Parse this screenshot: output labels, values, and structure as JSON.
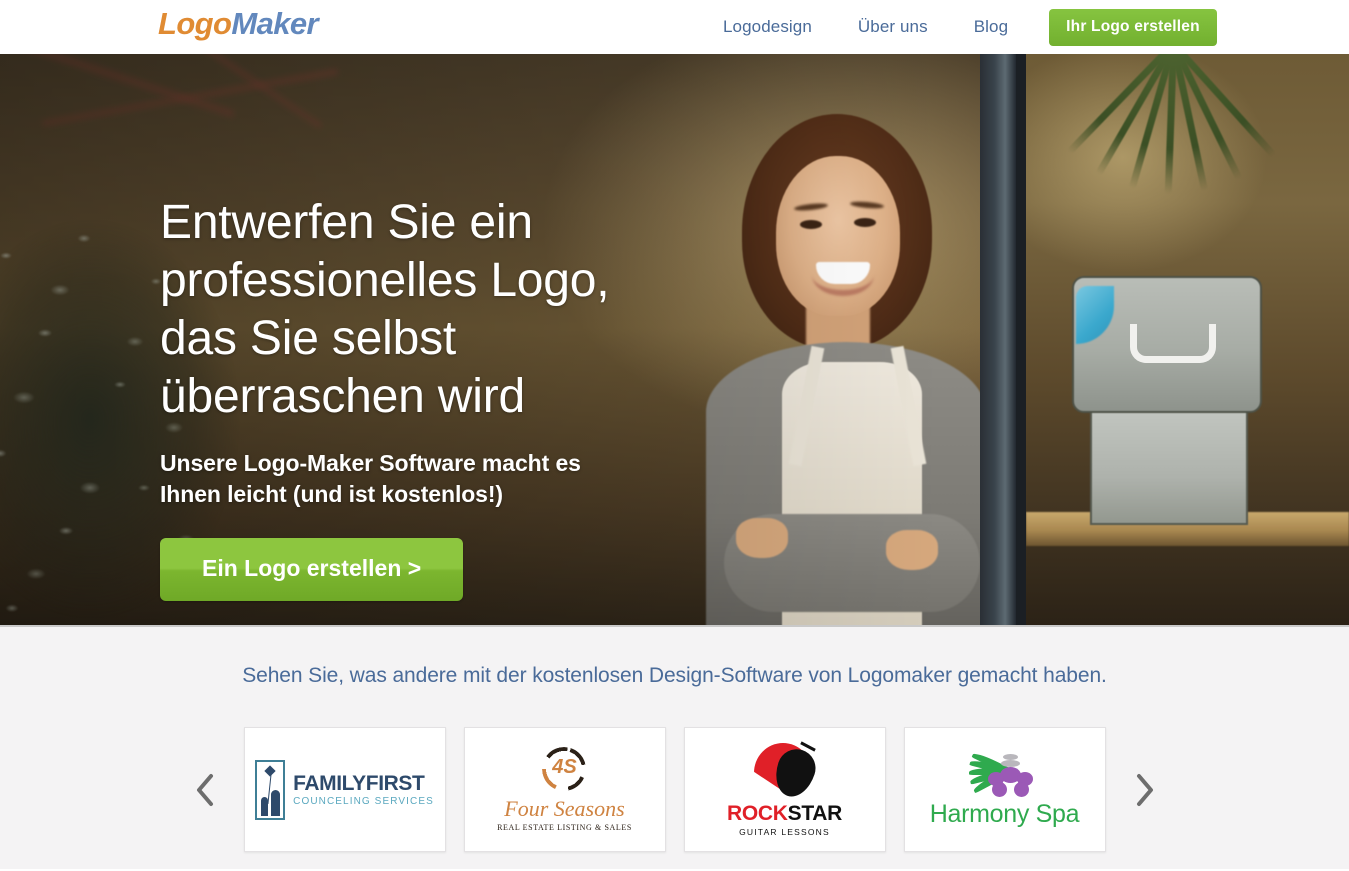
{
  "header": {
    "logo_part_a": "Logo",
    "logo_part_b": "Maker",
    "nav": [
      {
        "label": "Logodesign",
        "name": "nav-link-logodesign"
      },
      {
        "label": "Über uns",
        "name": "nav-link-ueber-uns"
      },
      {
        "label": "Blog",
        "name": "nav-link-blog"
      }
    ],
    "cta_label": "Ihr Logo erstellen",
    "cta_color": "#7cb62f",
    "nav_link_color": "#4a6b99",
    "logo_color_a": "#e08b33",
    "logo_color_b": "#6288bd"
  },
  "hero": {
    "title_lines": [
      "Entwerfen Sie ein",
      "professionelles Logo,",
      "das Sie selbst",
      "überraschen wird"
    ],
    "subtitle_lines": [
      "Unsere Logo-Maker Software macht es",
      "Ihnen leicht (und ist kostenlos!)"
    ],
    "button_label": "Ein Logo erstellen >",
    "button_color": "#8dc63f",
    "text_color": "#ffffff"
  },
  "showcase": {
    "heading": "Sehen Sie, was andere mit der kostenlosen Design-Software von Logomaker gemacht haben.",
    "heading_color": "#4a6b99",
    "prev_label": "‹",
    "next_label": "›",
    "background": "#f4f3f4",
    "cards": [
      {
        "name": "family-first",
        "primary": "FAMILYFIRST",
        "secondary": "COUNCELING SERVICES",
        "primary_color": "#2e4a6b",
        "secondary_color": "#5aa8bf"
      },
      {
        "name": "four-seasons",
        "monogram": "4S",
        "primary": "Four Seasons",
        "secondary": "REAL ESTATE LISTING & SALES",
        "primary_color": "#cf8341",
        "secondary_color": "#2b2118"
      },
      {
        "name": "rock-star",
        "primary_a": "ROCK",
        "primary_b": "STAR",
        "secondary": "GUITAR LESSONS",
        "primary_color_a": "#e02028",
        "primary_color_b": "#111111",
        "secondary_color": "#111111"
      },
      {
        "name": "harmony-spa",
        "primary": "Harmony Spa",
        "primary_color": "#2faa4e"
      }
    ]
  }
}
